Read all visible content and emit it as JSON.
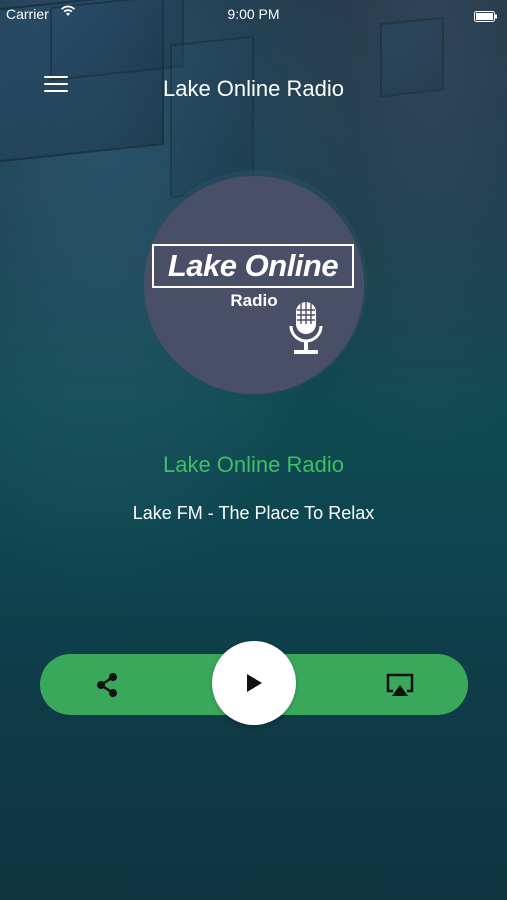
{
  "status_bar": {
    "carrier": "Carrier",
    "time": "9:00 PM"
  },
  "header": {
    "title": "Lake Online Radio",
    "menu_icon": "hamburger-menu-icon"
  },
  "logo": {
    "main_text": "Lake Online",
    "sub_text": "Radio",
    "icon": "microphone-icon"
  },
  "station": {
    "name": "Lake Online Radio",
    "slogan": "Lake FM - The Place To Relax"
  },
  "player": {
    "share_icon": "share-icon",
    "play_icon": "play-icon",
    "airplay_icon": "airplay-icon",
    "accent_color": "#3aa85a",
    "name_color": "#3fbf63"
  }
}
